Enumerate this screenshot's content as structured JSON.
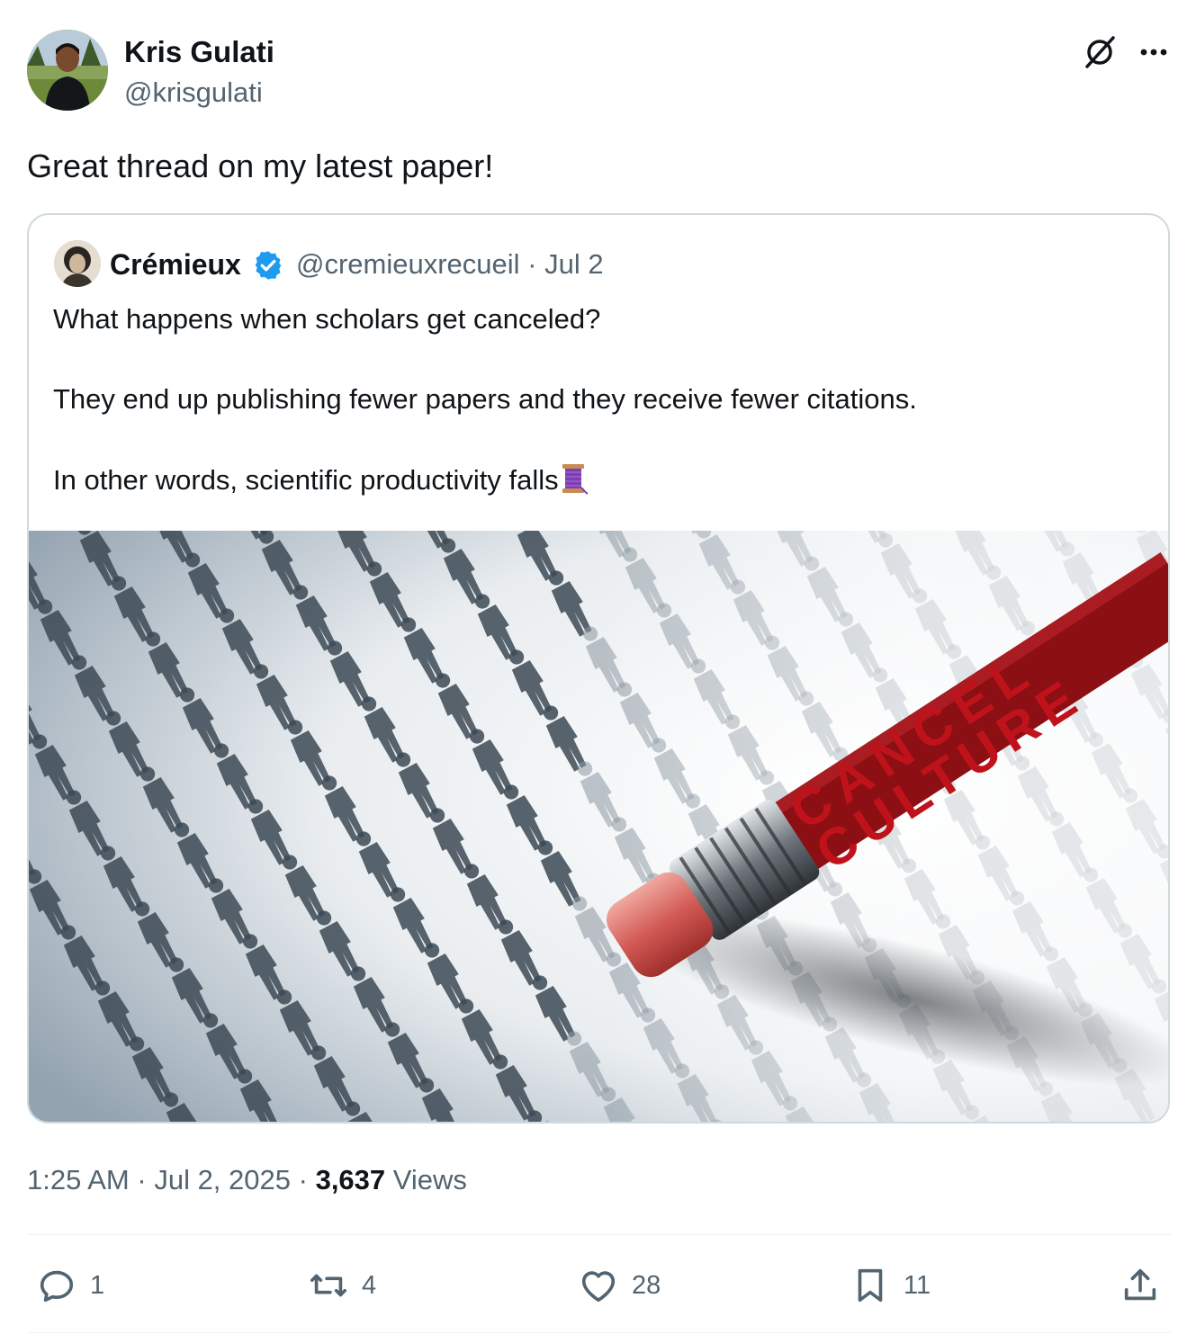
{
  "author": {
    "name": "Kris Gulati",
    "handle": "@krisgulati",
    "avatar_icon": "avatar-photo"
  },
  "header_icons": [
    "grok-icon",
    "more-icon"
  ],
  "tweet": {
    "text": "Great thread on my latest paper!"
  },
  "quoted_tweet": {
    "name": "Crémieux",
    "verified": true,
    "handle": "@cremieuxrecueil",
    "separator": "·",
    "date": "Jul 2",
    "lines": [
      "What happens when scholars get canceled?",
      "They end up publishing fewer papers and they receive fewer citations.",
      "In other words, scientific productivity falls"
    ],
    "emoji": "thread-spool-emoji",
    "image": {
      "word1": "CANCEL",
      "word2": "CULTURE"
    }
  },
  "meta": {
    "time": "1:25 AM",
    "sep1": "·",
    "date": "Jul 2, 2025",
    "sep2": "·",
    "views_count": "3,637",
    "views_label": "Views"
  },
  "actions": {
    "reply_count": "1",
    "retweet_count": "4",
    "like_count": "28",
    "bookmark_count": "11"
  },
  "colors": {
    "text": "#0f1419",
    "secondary": "#536471",
    "verified": "#1d9bf0",
    "border": "#cfd9de",
    "cancel_red": "#c0121b"
  }
}
